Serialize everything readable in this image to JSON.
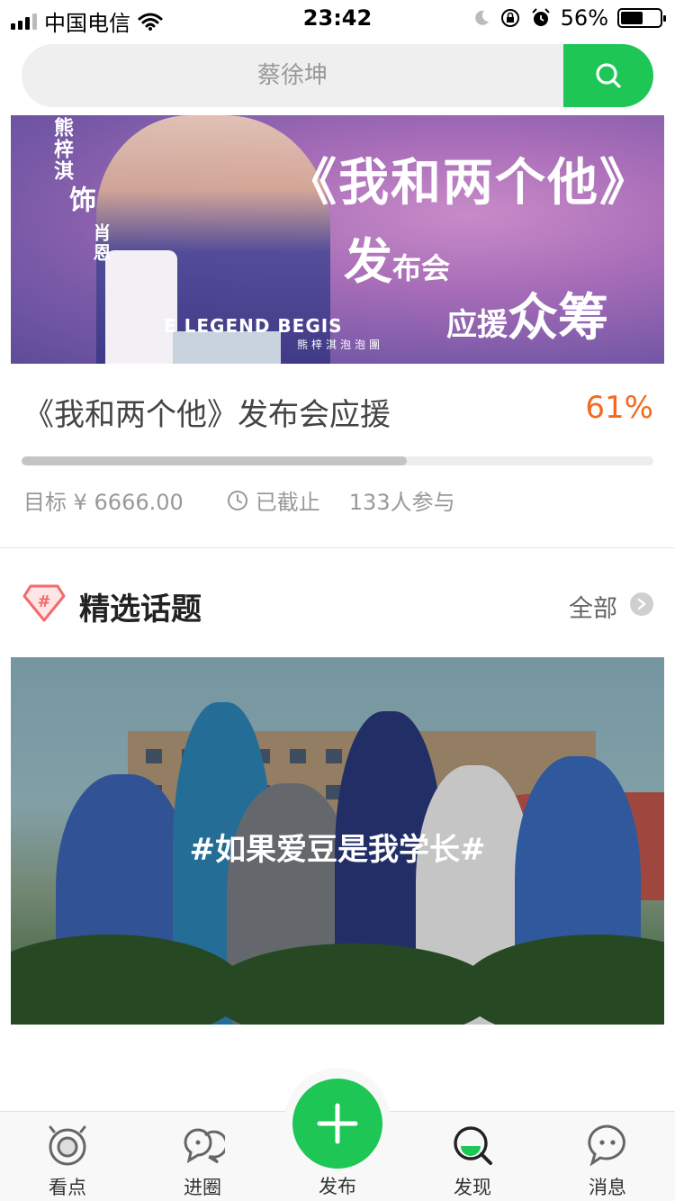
{
  "status_bar": {
    "carrier": "中国电信",
    "time": "23:42",
    "battery_percent": "56%",
    "battery_level": 0.56
  },
  "search": {
    "placeholder": "蔡徐坤",
    "button_icon": "search-icon"
  },
  "banner": {
    "actor_name": "熊梓淇",
    "plays": "饰",
    "role": "肖恩",
    "title": "《我和两个他》",
    "line2_big": "发",
    "line2_small": "布会",
    "line3_small": "应援",
    "line3_big": "众筹",
    "shirt_text": "E LEGEND BEGIS",
    "credit": "熊梓淇泡泡團",
    "accent_color": "#a86db8"
  },
  "crowdfund": {
    "title": "《我和两个他》发布会应援",
    "percent": "61%",
    "progress": 0.61,
    "target": "目标 ¥ 6666.00",
    "status": "已截止",
    "participants": "133人参与",
    "percent_color": "#f26b1d"
  },
  "featured": {
    "title": "精选话题",
    "all_label": "全部",
    "topic_label": "#如果爱豆是我学长#"
  },
  "tabbar": {
    "tabs": [
      {
        "label": "看点",
        "icon": "eye-icon"
      },
      {
        "label": "进圈",
        "icon": "circle-chat-icon"
      },
      {
        "label": "发布",
        "icon": "plus-icon"
      },
      {
        "label": "发现",
        "icon": "discover-icon",
        "active": true
      },
      {
        "label": "消息",
        "icon": "message-icon"
      }
    ],
    "accent_color": "#1dc655"
  }
}
